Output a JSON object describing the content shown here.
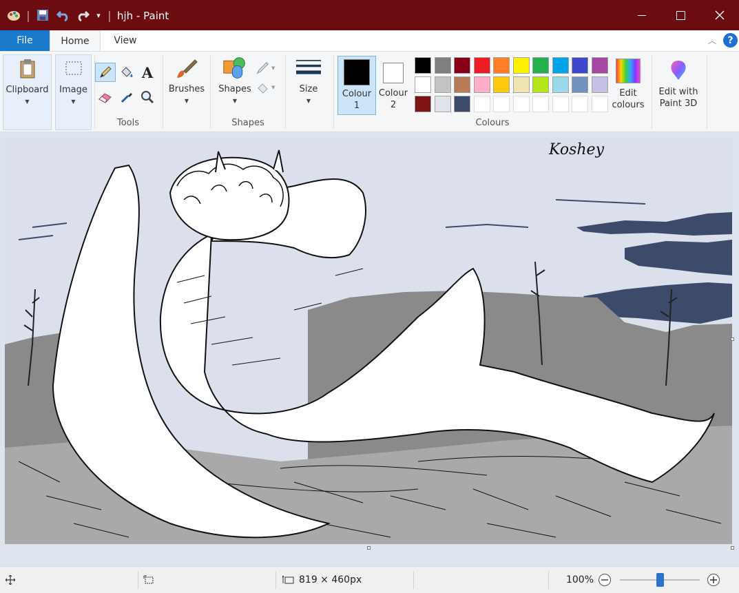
{
  "window": {
    "title": "hjh - Paint",
    "minimize_icon": "minimize-icon",
    "maximize_icon": "maximize-icon",
    "close_icon": "close-icon"
  },
  "quick_access": [
    "paint-app-icon",
    "save-icon",
    "undo-icon",
    "redo-icon",
    "customize-quick-access-icon"
  ],
  "tabs": [
    {
      "label": "File"
    },
    {
      "label": "Home"
    },
    {
      "label": "View"
    }
  ],
  "ribbon": {
    "clipboard": {
      "label": "Clipboard",
      "icon": "clipboard-icon"
    },
    "image": {
      "label": "Image",
      "icon": "select-icon"
    },
    "tools": {
      "group_label": "Tools",
      "items": [
        "pencil-icon",
        "fill-icon",
        "text-icon",
        "eraser-icon",
        "colour-picker-icon",
        "magnifier-icon"
      ],
      "text_glyph": "A"
    },
    "brushes": {
      "label": "Brushes",
      "icon": "brush-icon"
    },
    "shapes": {
      "label": "Shapes",
      "group_label": "Shapes",
      "outline_icon": "outline-icon",
      "fill_icon": "shape-fill-icon"
    },
    "size": {
      "label": "Size",
      "icon": "size-icon"
    },
    "colours": {
      "group_label": "Colours",
      "colour1": {
        "line1": "Colour",
        "line2": "1",
        "value": "#000000"
      },
      "colour2": {
        "line1": "Colour",
        "line2": "2",
        "value": "#ffffff"
      },
      "palette_row1": [
        "#000000",
        "#7f7f7f",
        "#880015",
        "#ed1c24",
        "#ff7f27",
        "#fff200",
        "#22b14c",
        "#00a2e8",
        "#3f48cc",
        "#a349a4"
      ],
      "palette_row2": [
        "#ffffff",
        "#c3c3c3",
        "#b97a57",
        "#ffaec9",
        "#ffc90e",
        "#efe4b0",
        "#b5e61d",
        "#99d9ea",
        "#7092be",
        "#c8bfe7"
      ],
      "palette_row3": [
        "#7f1417",
        "#dfe3ea",
        "#3c4a6b",
        "",
        "",
        "",
        "",
        "",
        "",
        ""
      ],
      "edit": {
        "line1": "Edit",
        "line2": "colours",
        "icon": "edit-colours-icon"
      }
    },
    "paint3d": {
      "line1": "Edit with",
      "line2": "Paint 3D",
      "icon": "paint-3d-icon"
    },
    "collapse_icon": "collapse-ribbon-icon",
    "help_icon": "help-icon",
    "help_glyph": "?"
  },
  "canvas": {
    "signature": "Koshey",
    "sky_color": "#dbe0ec",
    "cloud_color": "#3d4b6b",
    "hill_color": "#8a8a8a",
    "ground_color": "#a9a9a9"
  },
  "status": {
    "cursor_icon": "cursor-position-icon",
    "selection_icon": "selection-size-icon",
    "image_size_icon": "image-size-icon",
    "image_size": "819 × 460px",
    "zoom": "100%",
    "zoom_level": 100,
    "zoom_out_icon": "zoom-out-icon",
    "zoom_in_icon": "zoom-in-icon"
  }
}
